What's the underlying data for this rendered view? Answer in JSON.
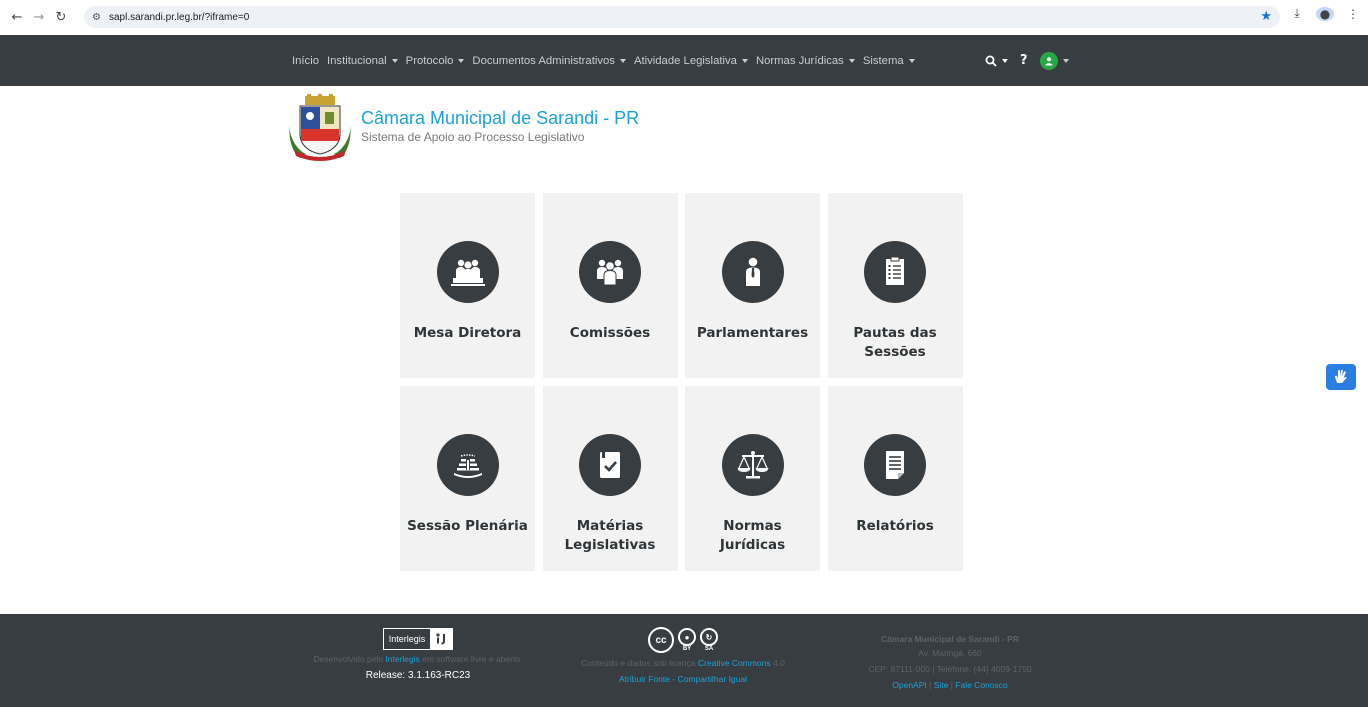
{
  "browser": {
    "url": "sapl.sarandi.pr.leg.br/?iframe=0"
  },
  "nav": {
    "items": [
      {
        "label": "Início",
        "has_caret": false
      },
      {
        "label": "Institucional",
        "has_caret": true
      },
      {
        "label": "Protocolo",
        "has_caret": true
      },
      {
        "label": "Documentos Administrativos",
        "has_caret": true
      },
      {
        "label": "Atividade Legislativa",
        "has_caret": true
      },
      {
        "label": "Normas Jurídicas",
        "has_caret": true
      },
      {
        "label": "Sistema",
        "has_caret": true
      }
    ],
    "help_label": "?"
  },
  "header": {
    "title": "Câmara Municipal de Sarandi - PR",
    "subtitle": "Sistema de Apoio ao Processo Legislativo"
  },
  "tiles": [
    {
      "label": "Mesa Diretora",
      "icon": "board-icon"
    },
    {
      "label": "Comissões",
      "icon": "committee-icon"
    },
    {
      "label": "Parlamentares",
      "icon": "parliamentarian-icon"
    },
    {
      "label": "Pautas das Sessões",
      "icon": "agenda-icon"
    },
    {
      "label": "Sessão Plenária",
      "icon": "plenary-icon"
    },
    {
      "label": "Matérias Legislativas",
      "icon": "document-check-icon"
    },
    {
      "label": "Normas Jurídicas",
      "icon": "scales-icon"
    },
    {
      "label": "Relatórios",
      "icon": "report-icon"
    }
  ],
  "footer": {
    "left": {
      "logo_text": "Interlegis",
      "line_pre": "Desenvolvido pelo ",
      "line_link": "Interlegis",
      "line_post": " em software livre e aberto.",
      "release": "Release: 3.1.163-RC23"
    },
    "center": {
      "cc": "cc",
      "by": "BY",
      "sa": "SA",
      "line_pre": "Conteúdo e dados sob licença ",
      "line_link": "Creative Commons",
      "line_post": " 4.0",
      "link2": "Atribuir Fonte - Compartilhar Igual"
    },
    "right": {
      "title": "Câmara Municipal de Sarandi - PR",
      "address": "Av. Maringá, 660",
      "contact": "CEP: 87111-000 | Telefone: (44) 4009-1750",
      "link_openapi": "OpenAPI",
      "sep": " | ",
      "link_site": "Site",
      "link_contact": "Fale Conosco"
    }
  },
  "colors": {
    "nav_bg": "#383d41",
    "accent": "#1ca1d8",
    "tile_bg": "#f2f2f2"
  }
}
